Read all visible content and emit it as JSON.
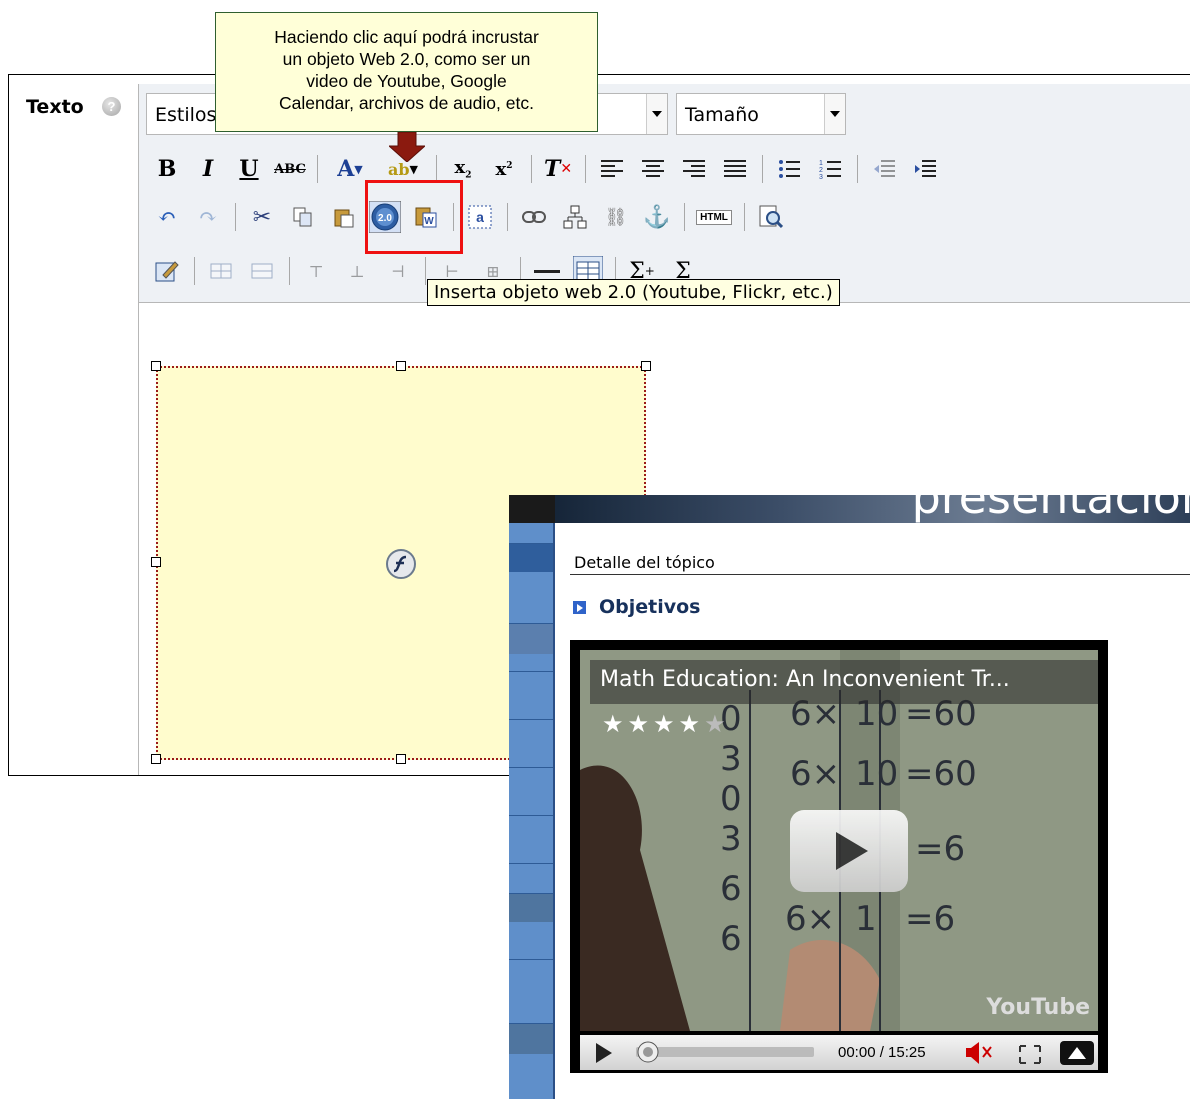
{
  "callout": {
    "lines": [
      "Haciendo clic aquí podrá incrustar",
      "un objeto Web 2.0, como ser un",
      "video de Youtube, Google",
      "Calendar, archivos de audio, etc."
    ]
  },
  "editor": {
    "field_label": "Texto",
    "styles_select": "Estilos",
    "size_select": "Tamaño",
    "tooltip": "Inserta objeto web 2.0 (Youtube, Flickr, etc.)",
    "web20_badge": "2.0",
    "html_button": "HTML"
  },
  "colors": {
    "callout_bg": "#ffffd8",
    "highlight": "#e11111",
    "flash_bg": "#fffccd",
    "sidebar": "#5f8fca"
  },
  "overlay": {
    "banner_text": "presentación",
    "section": "Detalle del tópico",
    "subsection": "Objetivos",
    "video": {
      "title": "Math Education: An Inconvenient Tr...",
      "rating_stars": 4.5,
      "time": "00:00 / 15:25",
      "logo": "YouTube"
    }
  }
}
